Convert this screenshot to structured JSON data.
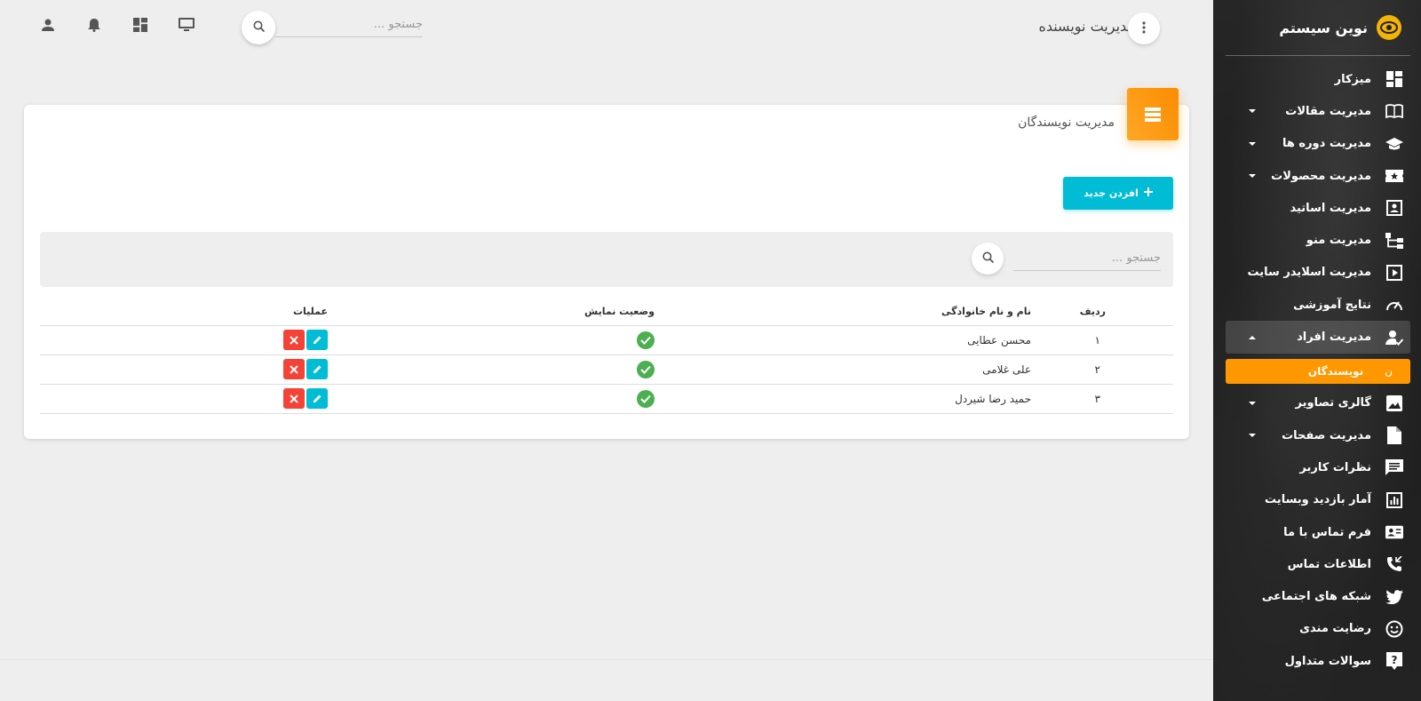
{
  "brand": {
    "name": "نوین سیستم",
    "accent": "#f3b406"
  },
  "sidebar": {
    "items": [
      {
        "label": "میزکار",
        "icon": "dashboard-icon",
        "caret": false
      },
      {
        "label": "مدیریت مقالات",
        "icon": "book-icon",
        "caret": true
      },
      {
        "label": "مدیریت دوره ها",
        "icon": "school-icon",
        "caret": true
      },
      {
        "label": "مدیریت محصولات",
        "icon": "ticket-icon",
        "caret": true
      },
      {
        "label": "مدیریت اساتید",
        "icon": "contact-icon",
        "caret": false
      },
      {
        "label": "مدیریت منو",
        "icon": "tree-icon",
        "caret": false
      },
      {
        "label": "مدیریت اسلایدر سایت",
        "icon": "slider-icon",
        "caret": false
      },
      {
        "label": "نتایج آموزشی",
        "icon": "speed-icon",
        "caret": false
      },
      {
        "label": "مدیریت افراد",
        "icon": "person-icon",
        "caret": true,
        "open": true
      },
      {
        "label": "گالری تصاویر",
        "icon": "image-icon",
        "caret": true
      },
      {
        "label": "مدیریت صفحات",
        "icon": "file-icon",
        "caret": true
      },
      {
        "label": "نظرات کاربر",
        "icon": "comment-icon",
        "caret": false
      },
      {
        "label": "آمار بازدید وبسایت",
        "icon": "chart-icon",
        "caret": false
      },
      {
        "label": "فرم تماس با ما",
        "icon": "contact-card-icon",
        "caret": false
      },
      {
        "label": "اطلاعات تماس",
        "icon": "phone-icon",
        "caret": false
      },
      {
        "label": "شبکه های اجتماعی",
        "icon": "twitter-icon",
        "caret": false
      },
      {
        "label": "رضایت مندی",
        "icon": "smile-icon",
        "caret": false
      },
      {
        "label": "سوالات متداول",
        "icon": "help-icon",
        "caret": false
      }
    ],
    "sub_item": {
      "mini": "ن",
      "label": "نویسندگان",
      "color": "#ff9800"
    }
  },
  "topbar": {
    "title": "مدیریت نویسنده",
    "search_placeholder": "جستجو ...",
    "icons": [
      "monitor-icon",
      "dashboard-icon",
      "bell-icon",
      "user-icon"
    ]
  },
  "card": {
    "title": "مدیریت نویسندگان",
    "add_label": "افزدن جدید",
    "search_placeholder": "جستجو ...",
    "columns": [
      "ردیف",
      "نام و نام خانوادگی",
      "وضعیت نمایش",
      "عملیات"
    ],
    "rows": [
      {
        "idx": "۱",
        "name": "محسن عطایی"
      },
      {
        "idx": "۲",
        "name": "علی غلامی"
      },
      {
        "idx": "۳",
        "name": "حمید رضا شیردل"
      }
    ]
  }
}
